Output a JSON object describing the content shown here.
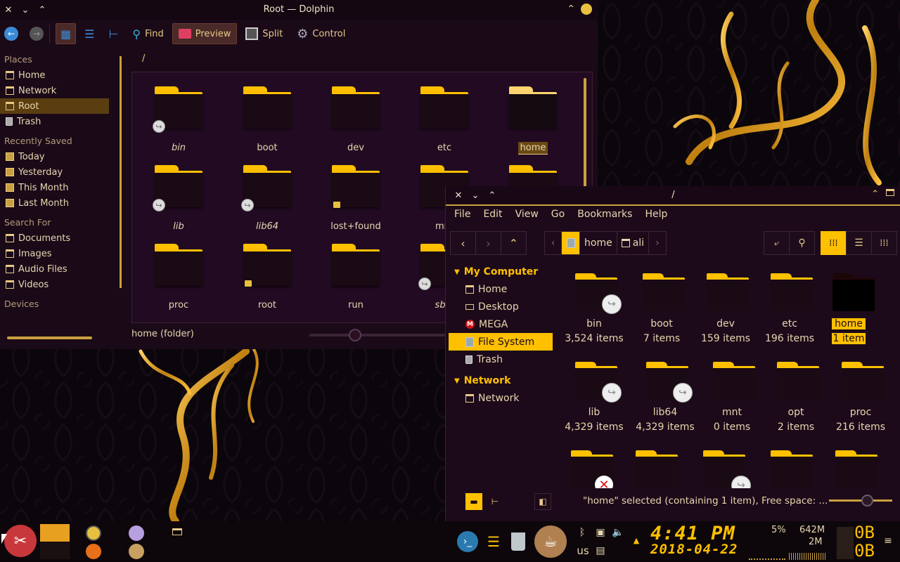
{
  "window1": {
    "title": "Root — Dolphin",
    "toolbar": {
      "find": "Find",
      "preview": "Preview",
      "split": "Split",
      "control": "Control"
    },
    "places": {
      "places_header": "Places",
      "places_items": [
        "Home",
        "Network",
        "Root",
        "Trash"
      ],
      "recent_header": "Recently Saved",
      "recent_items": [
        "Today",
        "Yesterday",
        "This Month",
        "Last Month"
      ],
      "search_header": "Search For",
      "search_items": [
        "Documents",
        "Images",
        "Audio Files",
        "Videos"
      ],
      "devices_header": "Devices"
    },
    "location": "/",
    "files": [
      {
        "name": "bin",
        "link": true
      },
      {
        "name": "boot"
      },
      {
        "name": "dev"
      },
      {
        "name": "etc"
      },
      {
        "name": "home",
        "selected": true
      },
      {
        "name": "lib",
        "link": true
      },
      {
        "name": "lib64",
        "link": true
      },
      {
        "name": "lost+found",
        "locked": true
      },
      {
        "name": "mnt"
      },
      {
        "name": ""
      },
      {
        "name": "proc"
      },
      {
        "name": "root",
        "locked": true
      },
      {
        "name": "run"
      },
      {
        "name": "sbin",
        "link": true
      }
    ],
    "status": "home (folder)"
  },
  "window2": {
    "title": "/",
    "menu": [
      "File",
      "Edit",
      "View",
      "Go",
      "Bookmarks",
      "Help"
    ],
    "breadcrumbs": [
      "home",
      "ali"
    ],
    "sidebar": {
      "my_computer": "My Computer",
      "computer_items": [
        "Home",
        "Desktop",
        "MEGA",
        "File System",
        "Trash"
      ],
      "network_header": "Network",
      "network_items": [
        "Network"
      ]
    },
    "files": [
      {
        "name": "bin",
        "count": "3,524 items",
        "link": true
      },
      {
        "name": "boot",
        "count": "7 items"
      },
      {
        "name": "dev",
        "count": "159 items"
      },
      {
        "name": "etc",
        "count": "196 items"
      },
      {
        "name": "home",
        "count": "1 item",
        "selected": true
      },
      {
        "name": "lib",
        "count": "4,329 items",
        "link": true
      },
      {
        "name": "lib64",
        "count": "4,329 items",
        "link": true
      },
      {
        "name": "mnt",
        "count": "0 items"
      },
      {
        "name": "opt",
        "count": "2 items"
      },
      {
        "name": "proc",
        "count": "216 items"
      }
    ],
    "status": "\"home\" selected (containing 1 item), Free space: ..."
  },
  "panel": {
    "time": "4:41 PM",
    "date": "2018-04-22",
    "keyboard_layout": "us",
    "cpu": "5%",
    "mem1": "642M",
    "mem2": "2M",
    "net_down": "0B",
    "net_up": "0B"
  },
  "colors": {
    "accent": "#ffc000",
    "background": "#1a0a18",
    "text": "#e8d6b0"
  }
}
